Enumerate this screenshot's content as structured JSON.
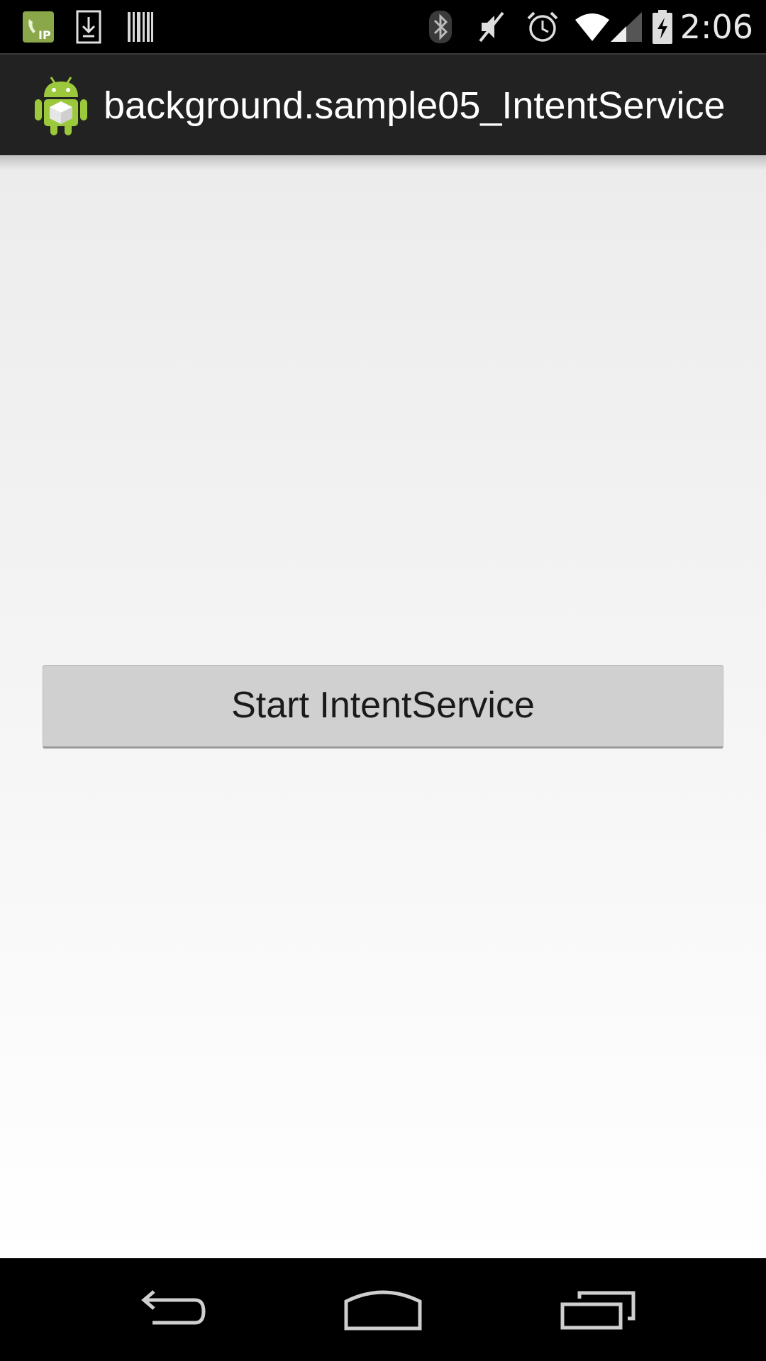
{
  "status_bar": {
    "time": "2:06",
    "left_icons": [
      "ip-call-icon",
      "download-icon",
      "barcode-icon"
    ],
    "right_icons": [
      "bluetooth-icon",
      "mute-icon",
      "alarm-icon",
      "wifi-icon",
      "signal-icon",
      "battery-charging-icon"
    ]
  },
  "action_bar": {
    "title": "background.sample05_IntentService",
    "logo_icon": "android-app-icon",
    "background_color": "#222222"
  },
  "main": {
    "start_button_label": "Start IntentService"
  },
  "nav_bar": {
    "buttons": [
      "back-icon",
      "home-icon",
      "recent-apps-icon"
    ]
  }
}
